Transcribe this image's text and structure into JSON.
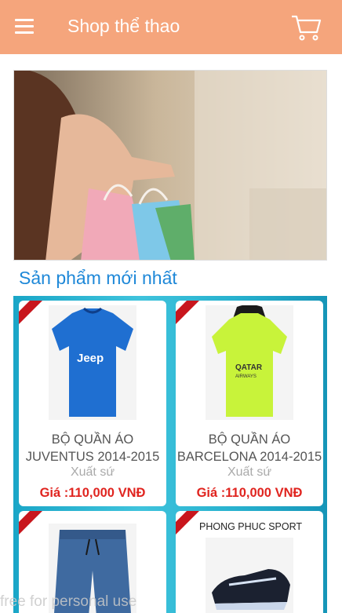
{
  "appbar": {
    "title": "Shop thể thao",
    "menu_icon": "hamburger-menu-icon",
    "cart_icon": "shopping-cart-icon",
    "color": "#f5a57c"
  },
  "section": {
    "title": "Sản phẩm mới nhất"
  },
  "products": [
    {
      "name_line1": "BỘ QUẦN ÁO",
      "name_line2": "JUVENTUS 2014-2015",
      "origin": "Xuất sứ",
      "price": "Giá :110,000 VNĐ",
      "badge": "NEW"
    },
    {
      "name_line1": "BỘ QUẦN ÁO",
      "name_line2": "BARCELONA 2014-2015",
      "origin": "Xuất sứ",
      "price": "Giá :110,000 VNĐ",
      "badge": "NEW"
    },
    {
      "badge": "NEW"
    },
    {
      "brand": "PHONG PHUC SPORT",
      "badge": "NEW"
    }
  ],
  "watermark": "free for personal use"
}
